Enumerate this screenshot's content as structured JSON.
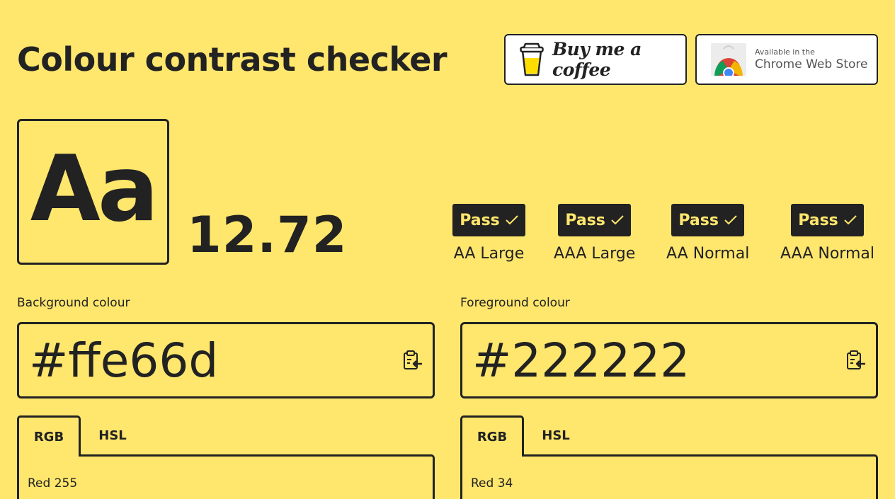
{
  "header": {
    "title": "Colour contrast checker",
    "coffee_label": "Buy me a coffee",
    "chrome_small": "Available in the",
    "chrome_big": "Chrome Web Store"
  },
  "preview": {
    "sample_text": "Aa",
    "ratio": "12.72"
  },
  "checks": [
    {
      "status": "Pass",
      "label": "AA Large"
    },
    {
      "status": "Pass",
      "label": "AAA Large"
    },
    {
      "status": "Pass",
      "label": "AA Normal"
    },
    {
      "status": "Pass",
      "label": "AAA Normal"
    }
  ],
  "background": {
    "label": "Background colour",
    "value": "#ffe66d",
    "tabs": [
      "RGB",
      "HSL"
    ],
    "active_tab": "RGB",
    "channel_label": "Red",
    "channel_value": "255"
  },
  "foreground": {
    "label": "Foreground colour",
    "value": "#222222",
    "tabs": [
      "RGB",
      "HSL"
    ],
    "active_tab": "RGB",
    "channel_label": "Red",
    "channel_value": "34"
  },
  "colors": {
    "background": "#ffe66d",
    "foreground": "#222222"
  },
  "icons": {
    "coffee": "coffee-cup-icon",
    "chrome": "chrome-logo-icon",
    "check": "checkmark-icon",
    "paste": "clipboard-paste-icon"
  }
}
